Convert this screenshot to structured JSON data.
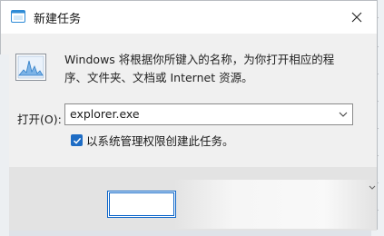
{
  "window": {
    "title": "新建任务"
  },
  "description": "Windows 将根据你所键入的名称，为你打开相应的程序、文件夹、文档或 Internet 资源。",
  "open_field": {
    "label": "打开(O):",
    "value": "explorer.exe"
  },
  "admin_checkbox": {
    "label": "以系统管理权限创建此任务。",
    "checked": true
  },
  "colors": {
    "accent": "#0a64c8",
    "checkbox": "#1e6cc4"
  },
  "icons": [
    "task-icon",
    "close-icon",
    "monitor-chart-icon",
    "chevron-down-icon"
  ]
}
